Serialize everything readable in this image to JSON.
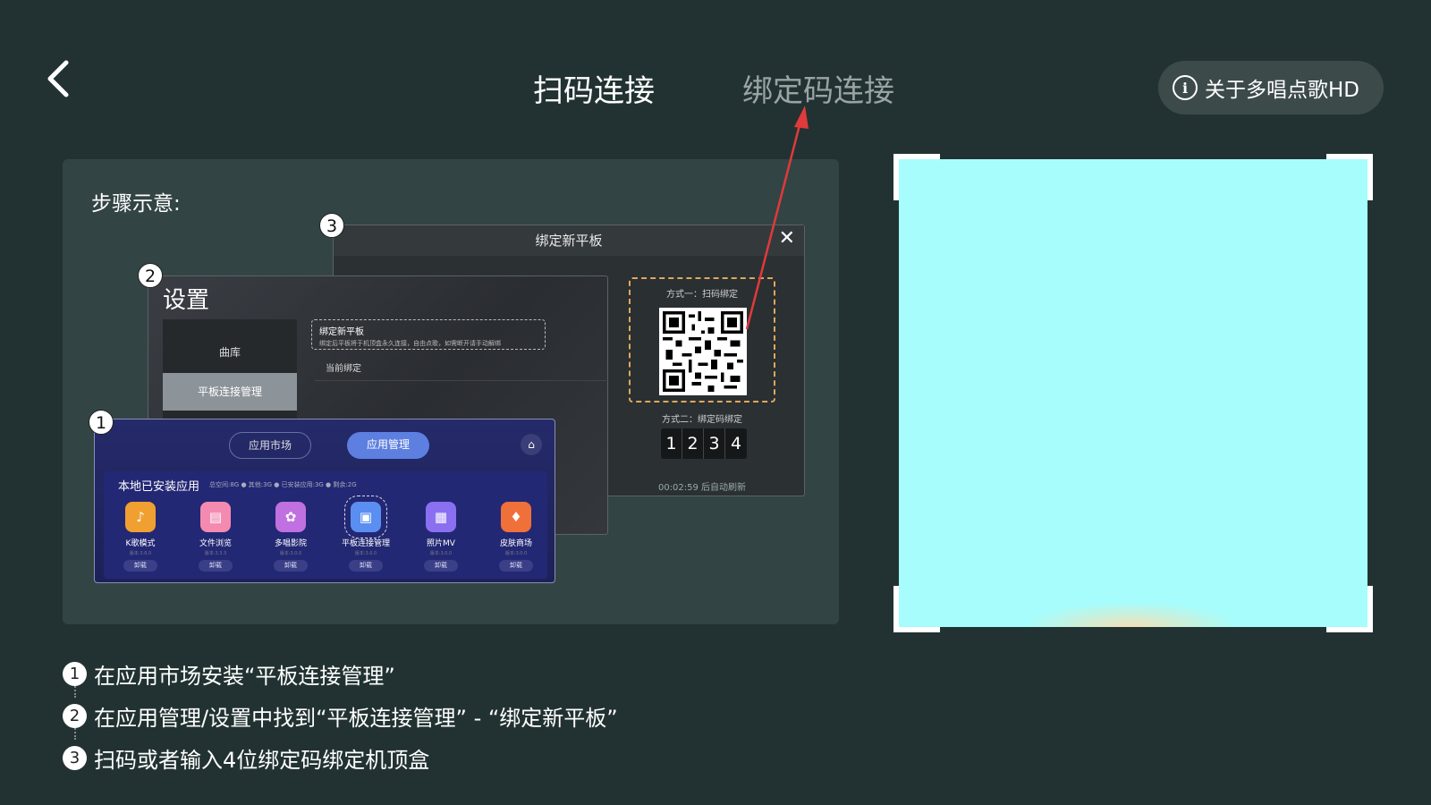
{
  "header": {
    "tabs": [
      {
        "label": "扫码连接",
        "active": true
      },
      {
        "label": "绑定码连接",
        "active": false
      }
    ],
    "about_label": "关于多唱点歌HD"
  },
  "panel": {
    "title": "步骤示意:",
    "window3": {
      "title": "绑定新平板",
      "method1": "方式一：扫码绑定",
      "method2": "方式二：绑定码绑定",
      "digits": [
        "1",
        "2",
        "3",
        "4"
      ],
      "refresh": "00:02:59 后自动刷新"
    },
    "window2": {
      "title": "设置",
      "side_items": [
        "曲库",
        "平板连接管理"
      ],
      "row1_title": "绑定新平板",
      "row1_desc": "绑定后平板将于机顶盒永久连接，自由点歌，如需断开请手动解绑",
      "row2": "当前绑定"
    },
    "window1": {
      "tab_market": "应用市场",
      "tab_manage": "应用管理",
      "section_title": "本地已安装应用",
      "stats": "总空间:8G  ● 其他:3G  ● 已安装应用:3G  ● 剩余:2G",
      "apps": [
        {
          "name": "K歌模式",
          "version": "版本:3.6.0",
          "action": "卸载",
          "color": "#f0a030"
        },
        {
          "name": "文件浏览",
          "version": "版本:3.3.3",
          "action": "卸载",
          "color": "#f58ab0"
        },
        {
          "name": "多唱影院",
          "version": "版本:3.0.0",
          "action": "卸载",
          "color": "#c070e0"
        },
        {
          "name": "平板连接管理",
          "version": "版本:3.0.0",
          "action": "卸载",
          "color": "#5a8ef0"
        },
        {
          "name": "照片MV",
          "version": "版本:3.0.0",
          "action": "卸载",
          "color": "#8a70f0"
        },
        {
          "name": "皮肤商场",
          "version": "版本:3.0.0",
          "action": "卸载",
          "color": "#f0703a"
        }
      ]
    },
    "badges": [
      "1",
      "2",
      "3"
    ]
  },
  "steps": [
    {
      "num": "1",
      "text": "在应用市场安装“平板连接管理”"
    },
    {
      "num": "2",
      "text": "在应用管理/设置中找到“平板连接管理” - “绑定新平板”"
    },
    {
      "num": "3",
      "text": "扫码或者输入4位绑定码绑定机顶盒"
    }
  ],
  "colors": {
    "background": "#223232",
    "panel": "#334444",
    "qr_area": "#a7fdfc",
    "arrow": "#e03a3a"
  },
  "icons": {
    "back": "chevron-left-icon",
    "about": "info-icon",
    "close": "close-icon",
    "home": "home-icon"
  }
}
